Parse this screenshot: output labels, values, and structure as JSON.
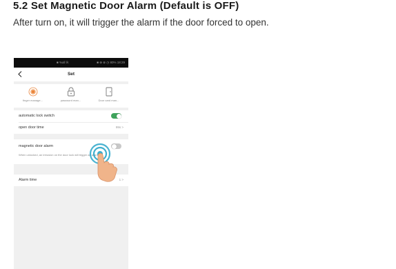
{
  "document": {
    "heading": "5.2 Set Magnetic Door Alarm (Default is OFF)",
    "text": "After turn on, it will trigger the alarm if the door forced to open."
  },
  "phone": {
    "statusbar": {
      "center": "■ %all ℝ",
      "right": "■ ⊕ ⊗ ◷ 80% 18:29"
    },
    "navbar": {
      "back_icon": "chevron-left-icon",
      "title": "Set"
    },
    "features": [
      {
        "label": "finger manage...",
        "icon": "fingerprint-icon",
        "color": "#e8833a"
      },
      {
        "label": "password man...",
        "icon": "lock-icon",
        "color": "#777777"
      },
      {
        "label": "Door card man...",
        "icon": "card-icon",
        "color": "#777777"
      }
    ],
    "settings": {
      "auto_lock": {
        "label": "automatic lock switch",
        "state": "on"
      },
      "open_door_time": {
        "label": "open door time",
        "value": "99s >"
      },
      "magnetic_alarm": {
        "label": "magnetic door alarm",
        "description": "When unlocked, an intrusion on the door lock will trigger an alarm",
        "state": "off"
      },
      "alarm_time": {
        "label": "Alarm time",
        "value": "1 >"
      }
    },
    "colors": {
      "toggle_on": "#3fa35c",
      "toggle_off": "#c8c8c8",
      "tap_ring": "#2aa6c9",
      "hand": "#f0b48a"
    }
  }
}
